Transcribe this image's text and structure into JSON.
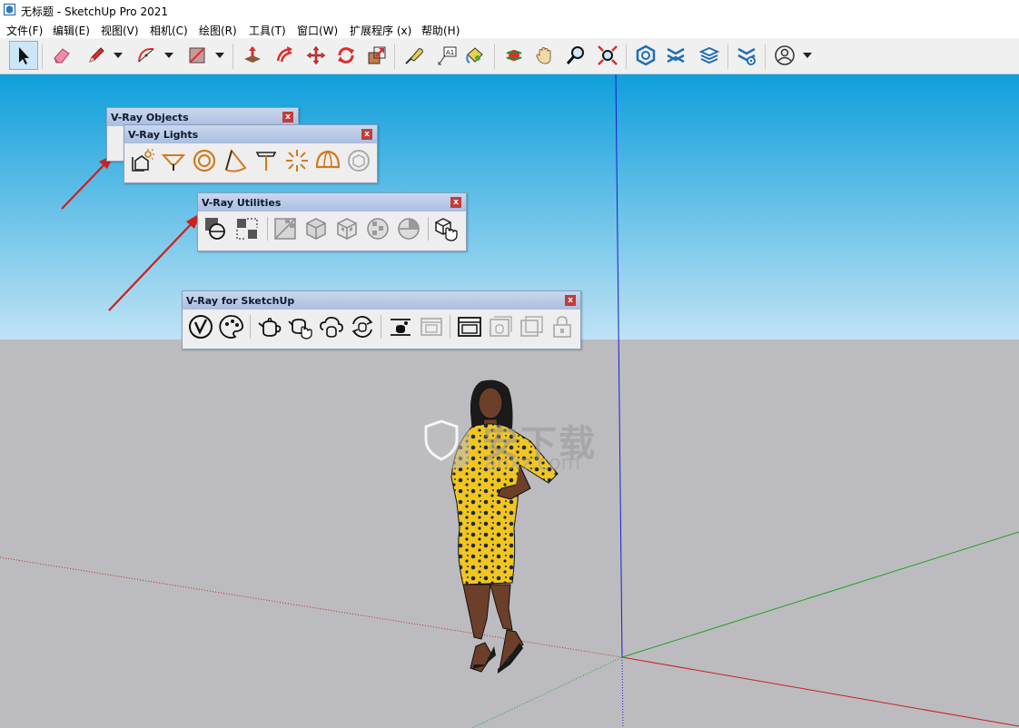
{
  "window": {
    "title": "无标题 - SketchUp Pro 2021",
    "app_icon": "sketchup-logo-icon"
  },
  "menu": {
    "items": [
      "文件(F)",
      "编辑(E)",
      "视图(V)",
      "相机(C)",
      "绘图(R)",
      "工具(T)",
      "窗口(W)",
      "扩展程序 (x)",
      "帮助(H)"
    ]
  },
  "toolbar": {
    "tools": [
      {
        "name": "select-tool",
        "icon": "arrow-cursor-icon",
        "selected": true
      },
      {
        "name": "eraser-tool",
        "icon": "eraser-icon"
      },
      {
        "name": "line-tool",
        "icon": "pencil-icon",
        "has_dropdown": true
      },
      {
        "name": "arc-tool",
        "icon": "arc-icon",
        "has_dropdown": true
      },
      {
        "name": "rectangle-tool",
        "icon": "rectangle-icon",
        "has_dropdown": true
      },
      {
        "name": "push-pull-tool",
        "icon": "push-pull-icon"
      },
      {
        "name": "offset-tool",
        "icon": "offset-icon"
      },
      {
        "name": "move-tool",
        "icon": "move-arrows-icon"
      },
      {
        "name": "rotate-tool",
        "icon": "rotate-icon"
      },
      {
        "name": "scale-tool",
        "icon": "scale-icon"
      },
      {
        "name": "tape-measure-tool",
        "icon": "tape-measure-icon"
      },
      {
        "name": "text-tool",
        "icon": "text-label-icon"
      },
      {
        "name": "paint-bucket-tool",
        "icon": "paint-bucket-icon"
      },
      {
        "name": "orbit-tool",
        "icon": "orbit-icon"
      },
      {
        "name": "pan-tool",
        "icon": "hand-icon"
      },
      {
        "name": "zoom-tool",
        "icon": "magnifier-icon"
      },
      {
        "name": "zoom-extents-tool",
        "icon": "zoom-extents-icon"
      },
      {
        "name": "3d-warehouse-button",
        "icon": "warehouse-icon"
      },
      {
        "name": "extension-warehouse-button",
        "icon": "extension-warehouse-icon"
      },
      {
        "name": "sketchup-layout-button",
        "icon": "layout-stack-icon"
      },
      {
        "name": "extension-manager-button",
        "icon": "extension-manager-icon"
      },
      {
        "name": "account-button",
        "icon": "user-avatar-icon",
        "has_dropdown": true
      }
    ]
  },
  "panels": {
    "objects": {
      "title": "V-Ray Objects",
      "close": "x"
    },
    "lights": {
      "title": "V-Ray Lights",
      "close": "x",
      "icons": [
        "rectangle-light-icon",
        "spot-light-icon",
        "sphere-light-icon",
        "cone-light-icon",
        "ies-light-icon",
        "omni-light-icon",
        "dome-light-icon",
        "mesh-light-icon"
      ]
    },
    "utilities": {
      "title": "V-Ray Utilities",
      "close": "x",
      "icons": [
        "material-picker-icon",
        "pick-focus-icon",
        "uvw-planar-icon",
        "uvw-box-icon",
        "uvw-cube-icon",
        "uvw-sphere-icon",
        "uvw-cylinder-icon",
        "pick-object-icon"
      ]
    },
    "sketchup": {
      "title": "V-Ray for SketchUp",
      "close": "x",
      "icons": [
        "vray-logo-icon",
        "asset-editor-icon",
        "render-teapot-icon",
        "interactive-render-icon",
        "cloud-render-icon",
        "batch-render-icon",
        "render-region-icon",
        "frame-buffer-icon",
        "viewport-render-icon",
        "render-to-viewport-icon",
        "lock-viewport-icon"
      ]
    }
  },
  "watermark": {
    "main": "安下载",
    "sub": "anxz.com"
  },
  "colors": {
    "sky_top": "#0f9fdc",
    "sky_bottom": "#bfe3f4",
    "ground": "#bcbcc0",
    "panel_header": "#b4c6e4",
    "close_red": "#c43c3c",
    "annotation_arrow": "#d11e1e",
    "axis_blue": "#1c1ccf",
    "axis_red": "#c82020",
    "axis_green": "#20a020",
    "icon_orange": "#d07a20"
  }
}
